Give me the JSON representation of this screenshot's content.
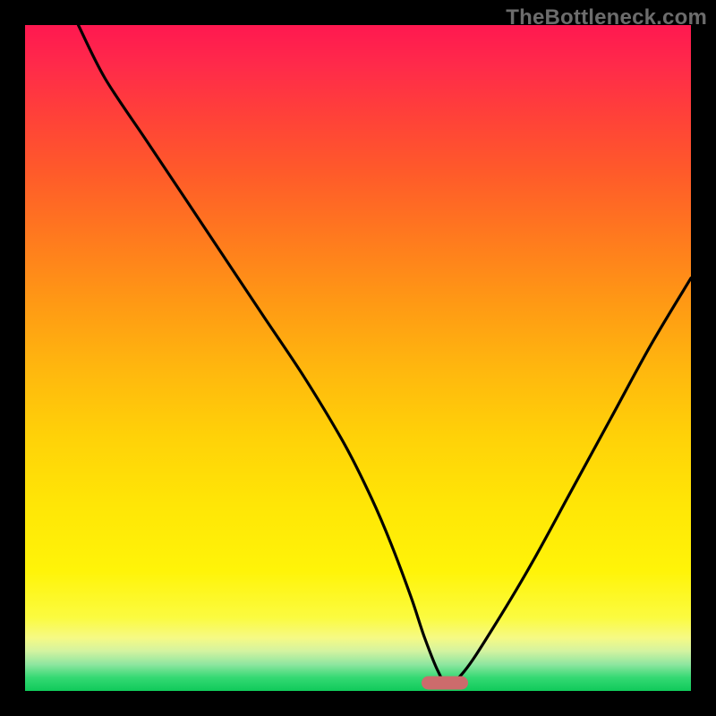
{
  "watermark": "TheBottleneck.com",
  "colors": {
    "frame_bg": "#000000",
    "gradient_top": "#ff1850",
    "gradient_mid": "#ffd208",
    "gradient_bottom": "#10ca5a",
    "curve": "#000000",
    "marker": "#cc6b6c"
  },
  "chart_data": {
    "type": "line",
    "title": "",
    "xlabel": "",
    "ylabel": "",
    "xlim": [
      0,
      100
    ],
    "ylim": [
      0,
      100
    ],
    "grid": false,
    "legend": false,
    "series": [
      {
        "name": "bottleneck-curve",
        "x": [
          8,
          12,
          18,
          24,
          30,
          36,
          42,
          48,
          52,
          55,
          58,
          60,
          62,
          63.5,
          66,
          70,
          76,
          82,
          88,
          94,
          100
        ],
        "values": [
          100,
          92,
          83,
          74,
          65,
          56,
          47,
          37,
          29,
          22,
          14,
          8,
          3,
          1,
          3,
          9,
          19,
          30,
          41,
          52,
          62
        ]
      }
    ],
    "marker": {
      "x": 63,
      "y": 1.2,
      "shape": "pill"
    },
    "gradient_stops": [
      {
        "pct": 0,
        "color": "#ff1850"
      },
      {
        "pct": 42,
        "color": "#ff9a14"
      },
      {
        "pct": 72,
        "color": "#ffe606"
      },
      {
        "pct": 96,
        "color": "#8fe6a0"
      },
      {
        "pct": 100,
        "color": "#10ca5a"
      }
    ]
  }
}
